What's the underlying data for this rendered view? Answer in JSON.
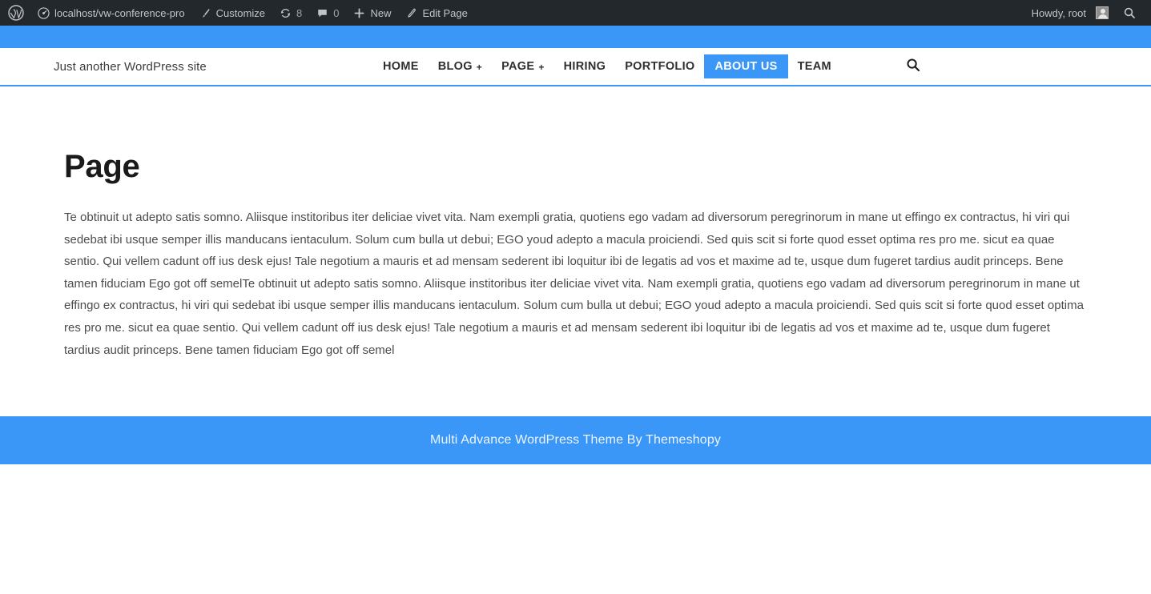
{
  "admin_bar": {
    "logo_icon": "wordpress-logo-icon",
    "site_link": {
      "icon": "dashboard-icon",
      "label": "localhost/vw-conference-pro"
    },
    "customize": {
      "icon": "brush-icon",
      "label": "Customize"
    },
    "updates": {
      "icon": "update-refresh-icon",
      "count": "8"
    },
    "comments": {
      "icon": "comment-bubble-icon",
      "count": "0"
    },
    "new": {
      "icon": "plus-icon",
      "label": "New"
    },
    "edit_page": {
      "icon": "pencil-icon",
      "label": "Edit Page"
    },
    "howdy": "Howdy, root",
    "avatar_icon": "user-avatar-icon",
    "search_icon": "search-icon"
  },
  "header": {
    "tagline": "Just another WordPress site",
    "search_icon": "search-icon",
    "nav": [
      {
        "label": "HOME",
        "has_dropdown": false,
        "active": false
      },
      {
        "label": "BLOG",
        "has_dropdown": true,
        "active": false,
        "dropdown_glyph": "+"
      },
      {
        "label": "PAGE",
        "has_dropdown": true,
        "active": false,
        "dropdown_glyph": "+"
      },
      {
        "label": "HIRING",
        "has_dropdown": false,
        "active": false
      },
      {
        "label": "PORTFOLIO",
        "has_dropdown": false,
        "active": false
      },
      {
        "label": "ABOUT US",
        "has_dropdown": false,
        "active": true
      },
      {
        "label": "TEAM",
        "has_dropdown": false,
        "active": false
      }
    ]
  },
  "main": {
    "title": "Page",
    "body": "Te obtinuit ut adepto satis somno. Aliisque institoribus iter deliciae vivet vita. Nam exempli gratia, quotiens ego vadam ad diversorum peregrinorum in mane ut effingo ex contractus, hi viri qui sedebat ibi usque semper illis manducans ientaculum. Solum cum bulla ut debui; EGO youd adepto a macula proiciendi. Sed quis scit si forte quod esset optima res pro me. sicut ea quae sentio. Qui vellem cadunt off ius desk ejus! Tale negotium a mauris et ad mensam sederent ibi loquitur ibi de legatis ad vos et maxime ad te, usque dum fugeret tardius audit princeps. Bene tamen fiduciam Ego got off semelTe obtinuit ut adepto satis somno. Aliisque institoribus iter deliciae vivet vita. Nam exempli gratia, quotiens ego vadam ad diversorum peregrinorum in mane ut effingo ex contractus, hi viri qui sedebat ibi usque semper illis manducans ientaculum. Solum cum bulla ut debui; EGO youd adepto a macula proiciendi. Sed quis scit si forte quod esset optima res pro me. sicut ea quae sentio. Qui vellem cadunt off ius desk ejus! Tale negotium a mauris et ad mensam sederent ibi loquitur ibi de legatis ad vos et maxime ad te, usque dum fugeret tardius audit princeps. Bene tamen fiduciam Ego got off semel"
  },
  "footer": {
    "text": "Multi Advance WordPress Theme By Themeshopy"
  },
  "colors": {
    "accent_blue": "#3a96f7",
    "admin_bar_bg": "#23282d",
    "admin_bar_text": "#c3c4c7",
    "body_text": "#4c4c4c",
    "title_text": "#1a1a1a",
    "footer_text": "#ecf5ff"
  }
}
